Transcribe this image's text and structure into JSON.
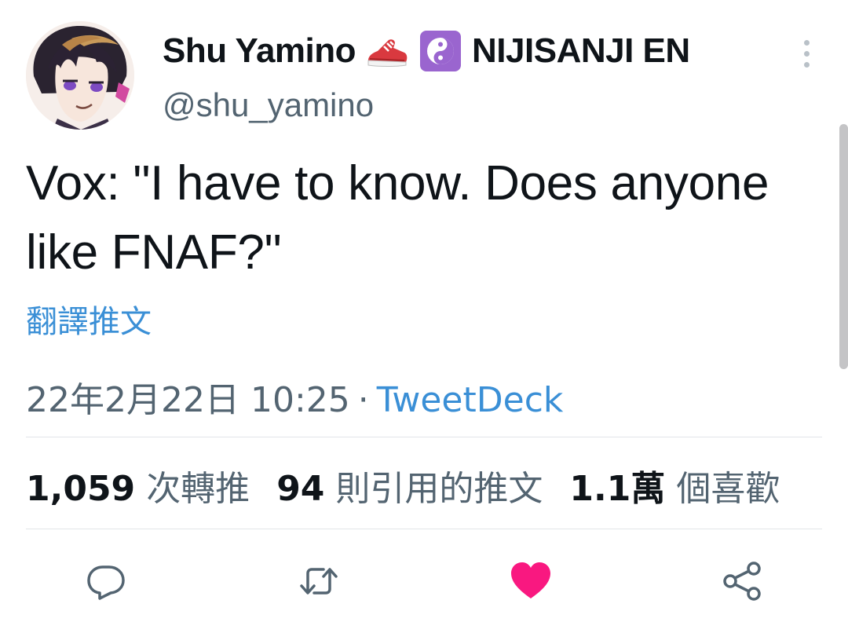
{
  "tweet": {
    "author": {
      "display_name": "Shu Yamino",
      "emoji": [
        "sneaker-emoji",
        "yin-yang-emoji"
      ],
      "affiliation": "NIJISANJI EN",
      "handle": "@shu_yamino"
    },
    "text": "Vox: \"I have to know. Does anyone like FNAF?\"",
    "translate_label": "翻譯推文",
    "timestamp": "22年2月22日 10:25",
    "separator": "·",
    "source": "TweetDeck"
  },
  "stats": {
    "retweets": {
      "count": "1,059",
      "label": "次轉推"
    },
    "quotes": {
      "count": "94",
      "label": "則引用的推文"
    },
    "likes": {
      "count": "1.1萬",
      "label": "個喜歡"
    }
  },
  "actions": [
    "reply-icon",
    "retweet-icon",
    "like-icon",
    "share-icon"
  ],
  "colors": {
    "link": "#3a8fd6",
    "secondary_text": "#536471",
    "like_active": "#f91880",
    "action_icon": "#536471"
  }
}
